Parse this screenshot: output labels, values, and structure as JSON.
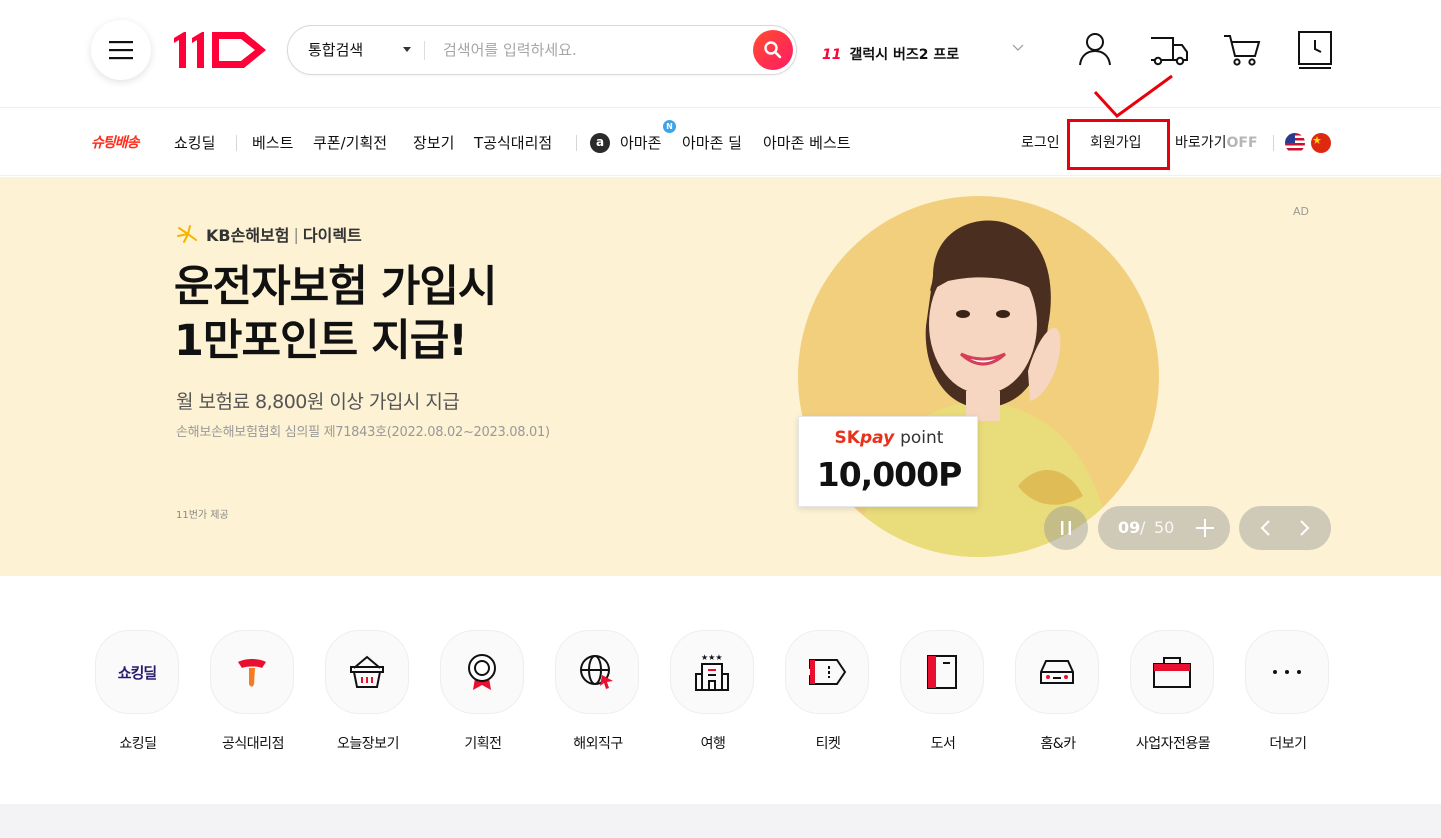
{
  "header": {
    "search": {
      "scope": "통합검색",
      "placeholder": "검색어를 입력하세요."
    },
    "trending": {
      "rank": "11",
      "keyword": "갤럭시 버즈2 프로"
    }
  },
  "nav": {
    "shooting_delivery": "슈팅배송",
    "items": [
      "쇼킹딜",
      "베스트",
      "쿠폰/기획전",
      "장보기",
      "T공식대리점"
    ],
    "amazon_logo": "a",
    "amazon_items": [
      "아마존",
      "아마존 딜",
      "아마존 베스트"
    ],
    "new_badge": "N",
    "utility": {
      "login": "로그인",
      "signup": "회원가입",
      "shortcut": "바로가기",
      "shortcut_state": "OFF"
    }
  },
  "banner": {
    "sponsor": "KB손해보험",
    "sponsor_sub": "다이렉트",
    "title_line1": "운전자보험 가입시",
    "title_line2": "1만포인트 지급!",
    "subtitle": "월 보험료 8,800원 이상 가입시 지급",
    "note": "손해보손해보험협회 심의필 제71843호(2022.08.02~2023.08.01)",
    "provider": "11번가 제공",
    "ad_label": "AD",
    "card_brand_sk": "SK",
    "card_brand_pay": "pay",
    "card_brand_point": "point",
    "card_amount": "10,000P",
    "slide_current": "09",
    "slide_separator": "/",
    "slide_total": "50"
  },
  "categories": [
    {
      "label": "쇼킹딜",
      "icon": "shocking-deal-icon",
      "icon_text": "쇼킹딜"
    },
    {
      "label": "공식대리점",
      "icon": "t-logo-icon"
    },
    {
      "label": "오늘장보기",
      "icon": "basket-icon"
    },
    {
      "label": "기획전",
      "icon": "medal-icon"
    },
    {
      "label": "해외직구",
      "icon": "globe-icon"
    },
    {
      "label": "여행",
      "icon": "hotel-icon"
    },
    {
      "label": "티켓",
      "icon": "ticket-icon"
    },
    {
      "label": "도서",
      "icon": "book-icon"
    },
    {
      "label": "홈&카",
      "icon": "car-icon"
    },
    {
      "label": "사업자전용몰",
      "icon": "briefcase-icon"
    },
    {
      "label": "더보기",
      "icon": "more-icon"
    }
  ],
  "colors": {
    "brand_red": "#ff0038",
    "banner_bg": "#fdf2d4",
    "annotation": "#e8000b"
  }
}
